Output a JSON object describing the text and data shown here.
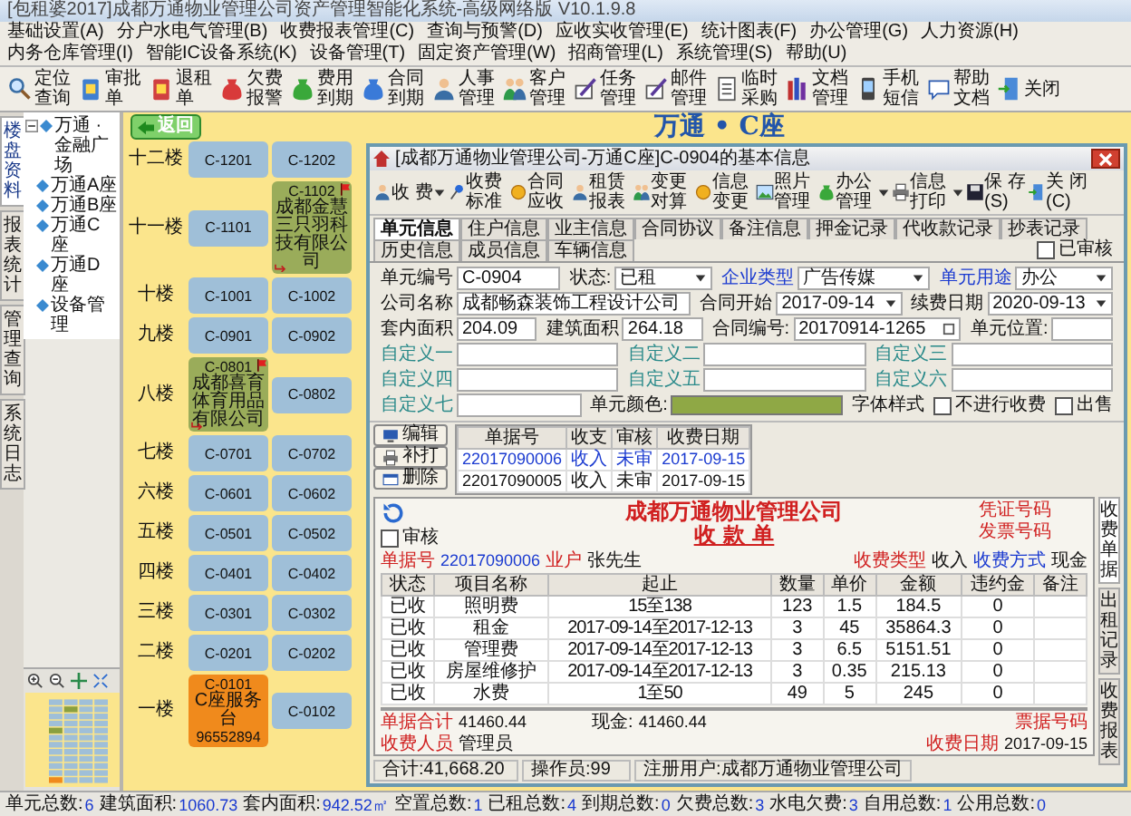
{
  "window": {
    "title": "[包租婆2017]成都万通物业管理公司资产管理智能化系统-高级网络版 V10.1.9.8"
  },
  "menu": [
    "基础设置(A)",
    "分户水电气管理(B)",
    "收费报表管理(C)",
    "查询与预警(D)",
    "应收实收管理(E)",
    "统计图表(F)",
    "办公管理(G)",
    "人力资源(H)",
    "内务仓库管理(I)",
    "智能IC设备系统(K)",
    "设备管理(T)",
    "固定资产管理(W)",
    "招商管理(L)",
    "系统管理(S)",
    "帮助(U)"
  ],
  "toolbar": [
    "定位查询",
    "审批单",
    "退租单",
    "欠费报警",
    "费用到期",
    "合同到期",
    "人事管理",
    "客户管理",
    "任务管理",
    "邮件管理",
    "临时采购",
    "文档管理",
    "手机短信",
    "帮助文档",
    "关闭"
  ],
  "sidebar": {
    "side_tabs": [
      {
        "label": "楼盘资料",
        "selected": true
      },
      {
        "label": "报表统计",
        "selected": false
      },
      {
        "label": "管理查询",
        "selected": false
      },
      {
        "label": "系统日志",
        "selected": false
      }
    ],
    "tree": [
      {
        "label": "万通 · 金融广场",
        "expanded": true,
        "children": [
          {
            "label": "万通A座"
          },
          {
            "label": "万通B座"
          },
          {
            "label": "万通C座"
          },
          {
            "label": "万通D座"
          },
          {
            "label": "设备管理"
          }
        ]
      }
    ]
  },
  "building": {
    "title": "万通 • C座",
    "back_button": "返回",
    "floors": [
      {
        "label": "十二楼",
        "units": [
          {
            "code": "C-1201",
            "color": "#9fbfd8",
            "flagged": false
          },
          {
            "code": "C-1202",
            "color": "#9fbfd8",
            "flagged": false
          }
        ]
      },
      {
        "label": "十一楼",
        "units": [
          {
            "code": "C-1101",
            "color": "#9fbfd8",
            "flagged": false
          },
          {
            "code": "C-1102",
            "color": "#9aac5a",
            "flagged": true,
            "tenant": "成都金慧三只羽科技有限公司"
          }
        ]
      },
      {
        "label": "十楼",
        "units": [
          {
            "code": "C-1001",
            "color": "#9fbfd8",
            "flagged": false
          },
          {
            "code": "C-1002",
            "color": "#9fbfd8",
            "flagged": false
          }
        ]
      },
      {
        "label": "九楼",
        "units": [
          {
            "code": "C-0901",
            "color": "#9fbfd8",
            "flagged": false
          },
          {
            "code": "C-0902",
            "color": "#9fbfd8",
            "flagged": false
          }
        ]
      },
      {
        "label": "八楼",
        "units": [
          {
            "code": "C-0801",
            "color": "#9aac5a",
            "flagged": true,
            "tenant": "成都喜育体育用品有限公司"
          },
          {
            "code": "C-0802",
            "color": "#9fbfd8",
            "flagged": false
          }
        ]
      },
      {
        "label": "七楼",
        "units": [
          {
            "code": "C-0701",
            "color": "#9fbfd8",
            "flagged": false
          },
          {
            "code": "C-0702",
            "color": "#9fbfd8",
            "flagged": false
          }
        ]
      },
      {
        "label": "六楼",
        "units": [
          {
            "code": "C-0601",
            "color": "#9fbfd8",
            "flagged": false
          },
          {
            "code": "C-0602",
            "color": "#9fbfd8",
            "flagged": false
          }
        ]
      },
      {
        "label": "五楼",
        "units": [
          {
            "code": "C-0501",
            "color": "#9fbfd8",
            "flagged": false
          },
          {
            "code": "C-0502",
            "color": "#9fbfd8",
            "flagged": false
          }
        ]
      },
      {
        "label": "四楼",
        "units": [
          {
            "code": "C-0401",
            "color": "#9fbfd8",
            "flagged": false
          },
          {
            "code": "C-0402",
            "color": "#9fbfd8",
            "flagged": false
          }
        ]
      },
      {
        "label": "三楼",
        "units": [
          {
            "code": "C-0301",
            "color": "#9fbfd8",
            "flagged": false
          },
          {
            "code": "C-0302",
            "color": "#9fbfd8",
            "flagged": false
          }
        ]
      },
      {
        "label": "二楼",
        "units": [
          {
            "code": "C-0201",
            "color": "#9fbfd8",
            "flagged": false
          },
          {
            "code": "C-0202",
            "color": "#9fbfd8",
            "flagged": false
          }
        ]
      },
      {
        "label": "一楼",
        "units": [
          {
            "code": "C-0101",
            "color": "#f08a1c",
            "flagged": false,
            "tenant": "C座服务台",
            "phone": "96552894"
          },
          {
            "code": "C-0102",
            "color": "#9fbfd8",
            "flagged": false
          }
        ]
      }
    ]
  },
  "dialog": {
    "title": "[成都万通物业管理公司-万通C座]C-0904的基本信息",
    "toolbar": [
      {
        "label": "收 费",
        "dropdown": true
      },
      {
        "label": "收费标准",
        "dropdown": false
      },
      {
        "label": "合同应收",
        "dropdown": false
      },
      {
        "label": "租赁报表",
        "dropdown": false
      },
      {
        "label": "变更对算",
        "dropdown": false
      },
      {
        "label": "信息变更",
        "dropdown": false
      },
      {
        "label": "照片管理",
        "dropdown": false
      },
      {
        "label": "办公管理",
        "dropdown": true
      },
      {
        "label": "信息打印",
        "dropdown": true
      },
      {
        "label": "保 存(S)",
        "dropdown": false
      },
      {
        "label": "关 闭(C)",
        "dropdown": false
      }
    ],
    "tabs": [
      {
        "label": "单元信息",
        "selected": true
      },
      {
        "label": "住户信息",
        "selected": false
      },
      {
        "label": "业主信息",
        "selected": false
      },
      {
        "label": "合同协议",
        "selected": false
      },
      {
        "label": "备注信息",
        "selected": false
      },
      {
        "label": "押金记录",
        "selected": false
      },
      {
        "label": "代收款记录",
        "selected": false
      },
      {
        "label": "抄表记录",
        "selected": false
      },
      {
        "label": "历史信息",
        "selected": false
      },
      {
        "label": "成员信息",
        "selected": false
      },
      {
        "label": "车辆信息",
        "selected": false
      }
    ],
    "reviewed": {
      "label": "已审核",
      "checked": false
    },
    "rows": [
      [
        {
          "label": "单元编号",
          "kind": "text",
          "value": "C-0904"
        },
        {
          "label": "状态:",
          "kind": "select",
          "value": "已租"
        },
        {
          "label": "企业类型",
          "color": "#1a3ad0",
          "kind": "select",
          "value": "广告传媒"
        },
        {
          "label": "单元用途",
          "color": "#1a3ad0",
          "kind": "select",
          "value": "办公"
        }
      ],
      [
        {
          "label": "公司名称",
          "kind": "text",
          "value": "成都畅森装饰工程设计公司"
        },
        {
          "label": "合同开始",
          "kind": "select",
          "value": "2017-09-14"
        },
        {
          "label": "续费日期",
          "kind": "select",
          "value": "2020-09-13"
        }
      ],
      [
        {
          "label": "套内面积",
          "kind": "text",
          "value": "204.09"
        },
        {
          "label": "建筑面积",
          "kind": "text",
          "value": "264.18"
        },
        {
          "label": "合同编号:",
          "kind": "picker",
          "value": "20170914-1265"
        },
        {
          "label": "单元位置:",
          "kind": "text"
        }
      ],
      [
        {
          "label": "自定义一",
          "color": "#2a8a8a",
          "kind": "text"
        },
        {
          "label": "自定义二",
          "color": "#2a8a8a",
          "kind": "text"
        },
        {
          "label": "自定义三",
          "color": "#2a8a8a",
          "kind": "text"
        }
      ],
      [
        {
          "label": "自定义四",
          "color": "#2a8a8a",
          "kind": "text"
        },
        {
          "label": "自定义五",
          "color": "#2a8a8a",
          "kind": "text"
        },
        {
          "label": "自定义六",
          "color": "#2a8a8a",
          "kind": "text"
        }
      ],
      [
        {
          "label": "自定义七",
          "color": "#2a8a8a",
          "kind": "text"
        },
        {
          "label": "单元颜色:",
          "kind": "color",
          "color": "#8fa845"
        },
        {
          "label": "字体样式",
          "kind": "label"
        },
        {
          "label": "不进行收费",
          "kind": "checkbox",
          "checked": false
        },
        {
          "label": "出售",
          "kind": "checkbox",
          "checked": false
        }
      ]
    ],
    "buttons": [
      "编辑",
      "补打",
      "删除"
    ],
    "receipt_list": {
      "columns": [
        "单据号",
        "收支",
        "审核",
        "收费日期"
      ],
      "rows": [
        {
          "cells": [
            "22017090006",
            "收入",
            "未审",
            "2017-09-15"
          ],
          "selected": true
        },
        {
          "cells": [
            "22017090005",
            "收入",
            "未审",
            "2017-09-15"
          ],
          "selected": false
        }
      ]
    },
    "receipt": {
      "company": "成都万通物业管理公司",
      "title": "收 款 单",
      "reviewed": {
        "label": "审核",
        "checked": false
      },
      "voucher_label": "凭证号码",
      "invoice_label": "发票号码",
      "doc_no_label": "单据号",
      "doc_no": "22017090006",
      "tenant_label": "业户",
      "tenant": "张先生",
      "fee_type_label": "收费类型",
      "fee_type": "收入",
      "pay_method_label": "收费方式",
      "pay_method": "现金",
      "columns": [
        "状态",
        "项目名称",
        "起止",
        "数量",
        "单价",
        "金额",
        "违约金",
        "备注"
      ],
      "items": [
        {
          "status": "已收",
          "item": "照明费",
          "period": "15至138",
          "qty": "123",
          "price": "1.5",
          "amount": "184.5",
          "penalty": "0"
        },
        {
          "status": "已收",
          "item": "租金",
          "period": "2017-09-14至2017-12-13",
          "qty": "3",
          "price": "45",
          "amount": "35864.3",
          "penalty": "0"
        },
        {
          "status": "已收",
          "item": "管理费",
          "period": "2017-09-14至2017-12-13",
          "qty": "3",
          "price": "6.5",
          "amount": "5151.51",
          "penalty": "0"
        },
        {
          "status": "已收",
          "item": "房屋维修护",
          "period": "2017-09-14至2017-12-13",
          "qty": "3",
          "price": "0.35",
          "amount": "215.13",
          "penalty": "0"
        },
        {
          "status": "已收",
          "item": "水费",
          "period": "1至50",
          "qty": "49",
          "price": "5",
          "amount": "245",
          "penalty": "0"
        }
      ],
      "total_label": "单据合计",
      "total": "41460.44",
      "cash_label": "现金:",
      "cash": "41460.44",
      "receipt_no_label": "票据号码",
      "cashier_label": "收费人员",
      "cashier": "管理员",
      "date_label": "收费日期",
      "date": "2017-09-15"
    },
    "side_tabs": [
      {
        "label": "收费单据",
        "selected": true
      },
      {
        "label": "出租记录",
        "selected": false
      },
      {
        "label": "收费报表",
        "selected": false
      }
    ],
    "status_bar": [
      "合计:41,668.20",
      "操作员:99",
      "注册用户:成都万通物业管理公司"
    ]
  },
  "status_bar": [
    {
      "label": "单元总数:",
      "value": "6"
    },
    {
      "label": "建筑面积:",
      "value": "1060.73"
    },
    {
      "label": "套内面积:",
      "value": "942.52㎡"
    },
    {
      "label": "空置总数:",
      "value": "1"
    },
    {
      "label": "已租总数:",
      "value": "4"
    },
    {
      "label": "到期总数:",
      "value": "0"
    },
    {
      "label": "欠费总数:",
      "value": "3"
    },
    {
      "label": "水电欠费:",
      "value": "3"
    },
    {
      "label": "自用总数:",
      "value": "1"
    },
    {
      "label": "公用总数:",
      "value": "0"
    }
  ]
}
